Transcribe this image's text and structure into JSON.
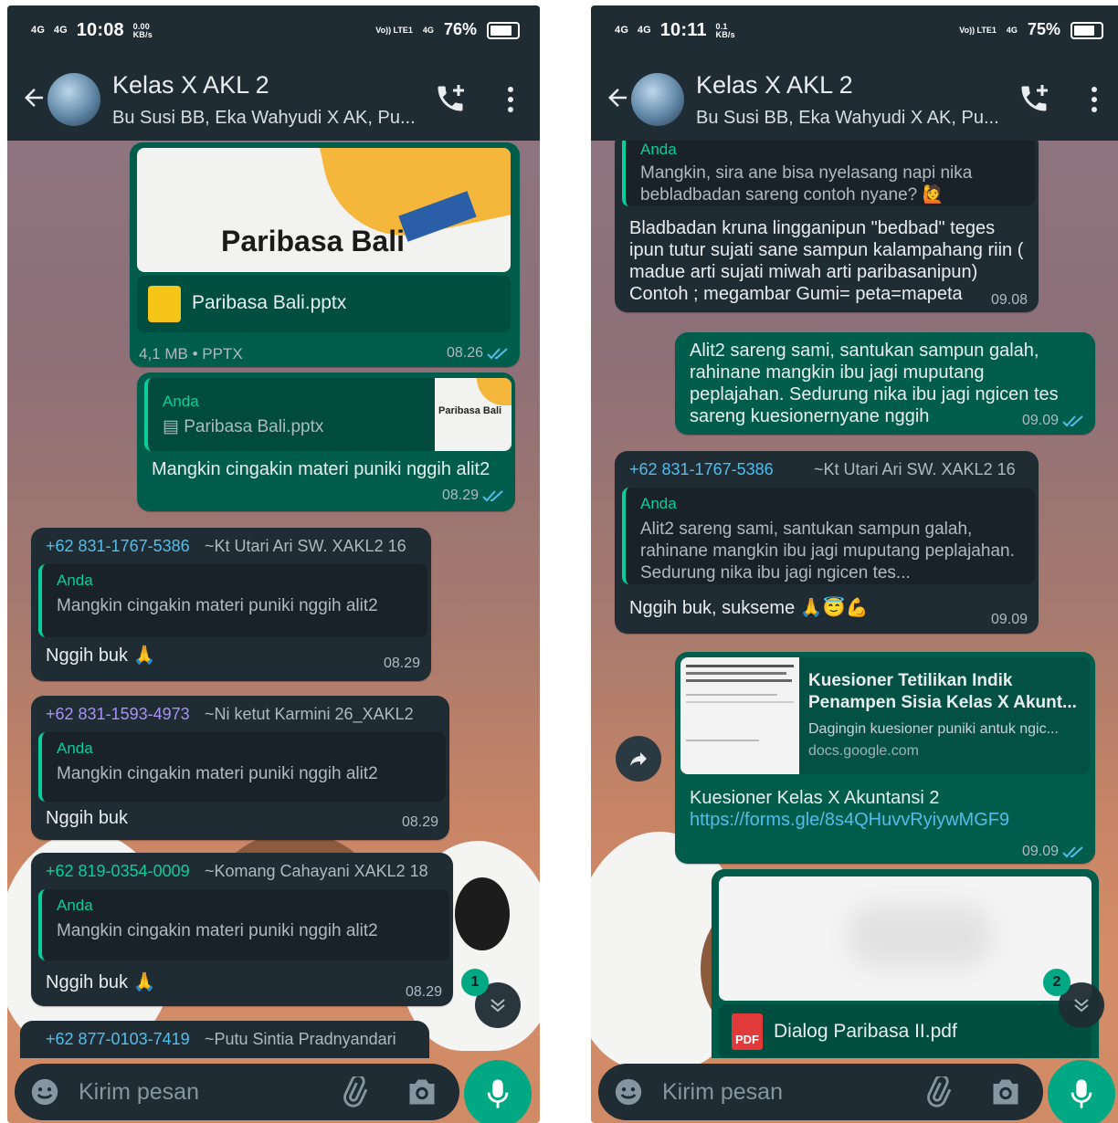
{
  "left": {
    "status": {
      "sig1": "4G",
      "sig2": "4G",
      "time": "10:08",
      "speed": "0.00",
      "speed_unit": "KB/s",
      "volte": "Vo)) LTE1",
      "net": "4G",
      "battery": "76%"
    },
    "header": {
      "title": "Kelas X AKL 2",
      "members": "Bu Susi BB, Eka Wahyudi X AK, Pu..."
    },
    "messages": {
      "m1": {
        "preview_title": "Paribasa Bali",
        "file_name": "Paribasa Bali.pptx",
        "meta": "4,1 MB • PPTX",
        "time": "08.26"
      },
      "m2": {
        "quote_author": "Anda",
        "quote_file": "Paribasa Bali.pptx",
        "thumb_text": "Paribasa Bali",
        "text": "Mangkin cingakin materi puniki nggih alit2",
        "time": "08.29"
      },
      "m3": {
        "phone": "+62 831-1767-5386",
        "name": "~Kt Utari Ari SW. XAKL2 16",
        "quote_author": "Anda",
        "quote_text": "Mangkin cingakin materi puniki nggih alit2",
        "text": "Nggih buk 🙏",
        "time": "08.29"
      },
      "m4": {
        "phone": "+62 831-1593-4973",
        "name": "~Ni ketut Karmini 26_XAKL2",
        "quote_author": "Anda",
        "quote_text": "Mangkin cingakin materi puniki nggih alit2",
        "text": "Nggih buk",
        "time": "08.29"
      },
      "m5": {
        "phone": "+62 819-0354-0009",
        "name": "~Komang Cahayani XAKL2 18",
        "quote_author": "Anda",
        "quote_text": "Mangkin cingakin materi puniki nggih alit2",
        "text": "Nggih buk 🙏",
        "time": "08.29"
      },
      "m6": {
        "phone": "+62 877-0103-7419",
        "name": "~Putu Sintia Pradnyandari"
      }
    },
    "unread_badge": "1",
    "input": {
      "placeholder": "Kirim pesan"
    }
  },
  "right": {
    "status": {
      "sig1": "4G",
      "sig2": "4G",
      "time": "10:11",
      "speed": "0.1",
      "speed_unit": "KB/s",
      "volte": "Vo)) LTE1",
      "net": "4G",
      "battery": "75%"
    },
    "header": {
      "title": "Kelas X AKL 2",
      "members": "Bu Susi BB, Eka Wahyudi X AK, Pu..."
    },
    "messages": {
      "r1": {
        "quote_author": "Anda",
        "quote_text": "Mangkin, sira ane bisa nyelasang napi nika bebladbadan sareng contoh nyane? 🙋",
        "text": "Bladbadan kruna lingganipun \"bedbad\" teges ipun tutur sujati sane sampun  kalampahang riin ( madue arti sujati miwah arti paribasanipun) Contoh ;  megambar Gumi= peta=mapeta",
        "time": "09.08"
      },
      "r2": {
        "text": "Alit2 sareng sami, santukan sampun galah, rahinane mangkin ibu jagi muputang peplajahan. Sedurung nika ibu jagi ngicen tes sareng kuesionernyane nggih",
        "time": "09.09"
      },
      "r3": {
        "phone": "+62 831-1767-5386",
        "name": "~Kt Utari Ari SW. XAKL2 16",
        "quote_author": "Anda",
        "quote_text": "Alit2 sareng sami, santukan sampun galah, rahinane mangkin ibu jagi muputang peplajahan. Sedurung nika ibu jagi ngicen tes...",
        "text": "Nggih buk, sukseme 🙏😇💪",
        "time": "09.09"
      },
      "r4": {
        "link_title": "Kuesioner Tetilikan Indik Penampen Sisia Kelas X Akunt...",
        "link_desc": "Dagingin kuesioner puniki antuk ngic...",
        "link_domain": "docs.google.com",
        "text": "Kuesioner Kelas X Akuntansi 2",
        "url": "https://forms.gle/8s4QHuvvRyiywMGF9",
        "time": "09.09"
      },
      "r5": {
        "file_name": "Dialog Paribasa II.pdf",
        "pdf_label": "PDF"
      }
    },
    "unread_badge": "2",
    "input": {
      "placeholder": "Kirim pesan"
    }
  },
  "colors": {
    "header": "#1f2c34",
    "outgoing": "#005c4b",
    "incoming": "#1f2c34",
    "accent": "#00a884",
    "phone_blue": "#53bdeb",
    "phone_purple": "#a792f5",
    "phone_green": "#06cf9c"
  }
}
